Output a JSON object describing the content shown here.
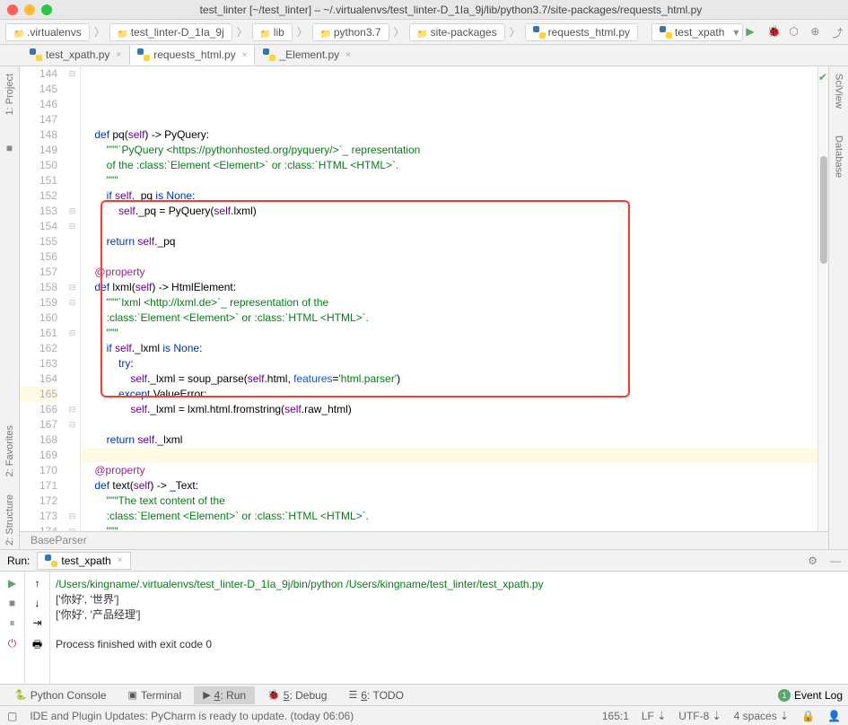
{
  "title": "test_linter [~/test_linter] – ~/.virtualenvs/test_linter-D_1Ia_9j/lib/python3.7/site-packages/requests_html.py",
  "breadcrumbs": [
    ".virtualenvs",
    "test_linter-D_1Ia_9j",
    "lib",
    "python3.7",
    "site-packages",
    "requests_html.py"
  ],
  "run_config": "test_xpath",
  "tabs": [
    {
      "label": "test_xpath.py",
      "active": false
    },
    {
      "label": "requests_html.py",
      "active": true
    },
    {
      "label": "_Element.py",
      "active": false
    }
  ],
  "left_rail": [
    "1: Project"
  ],
  "left_rail_bottom": [
    "2: Favorites",
    "2: Structure"
  ],
  "right_rail": [
    "SciView",
    "Database"
  ],
  "line_start": 144,
  "line_end": 174,
  "code_breadcrumb": "BaseParser",
  "run_label": "Run:",
  "run_tab": "test_xpath",
  "output": {
    "cmd": "/Users/kingname/.virtualenvs/test_linter-D_1Ia_9j/bin/python /Users/kingname/test_linter/test_xpath.py",
    "l1": "['你好', '世界']",
    "l2": "['你好', '产品经理']",
    "exit": "Process finished with exit code 0"
  },
  "bottom_tabs": {
    "console": "Python Console",
    "terminal": "Terminal",
    "run": "4: Run",
    "debug": "5: Debug",
    "todo": "6: TODO",
    "event": "Event Log"
  },
  "status": {
    "msg": "IDE and Plugin Updates: PyCharm is ready to update. (today 06:06)",
    "pos": "165:1",
    "lf": "LF",
    "enc": "UTF-8",
    "ind": "4 spaces"
  }
}
